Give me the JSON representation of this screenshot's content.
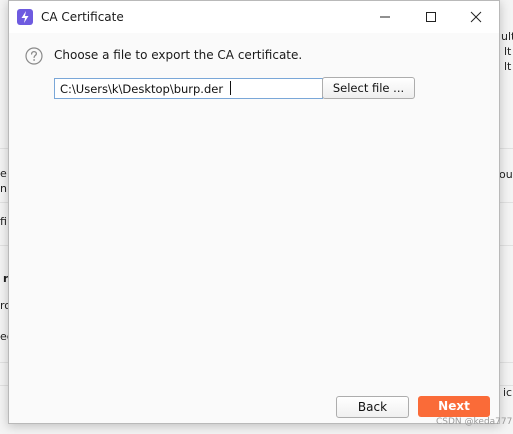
{
  "background": {
    "fragments": [
      "ult",
      "lt",
      "e",
      "n",
      "fi",
      "r",
      "ro",
      "ed",
      "ou",
      "ic"
    ]
  },
  "dialog": {
    "title": "CA Certificate",
    "prompt": "Choose a file to export the CA certificate.",
    "file_path": "C:\\Users\\k\\Desktop\\burp.der",
    "select_file_label": "Select file ...",
    "back_label": "Back",
    "next_label": "Next"
  },
  "colors": {
    "accent": "#fa6b38",
    "app_icon": "#6e5be0",
    "input_border": "#7aa7d8"
  },
  "icons": {
    "app": "lightning-icon",
    "help": "question-icon",
    "minimize": "minimize-icon",
    "maximize": "maximize-icon",
    "close": "close-icon"
  },
  "watermark": "CSDN @keda777"
}
